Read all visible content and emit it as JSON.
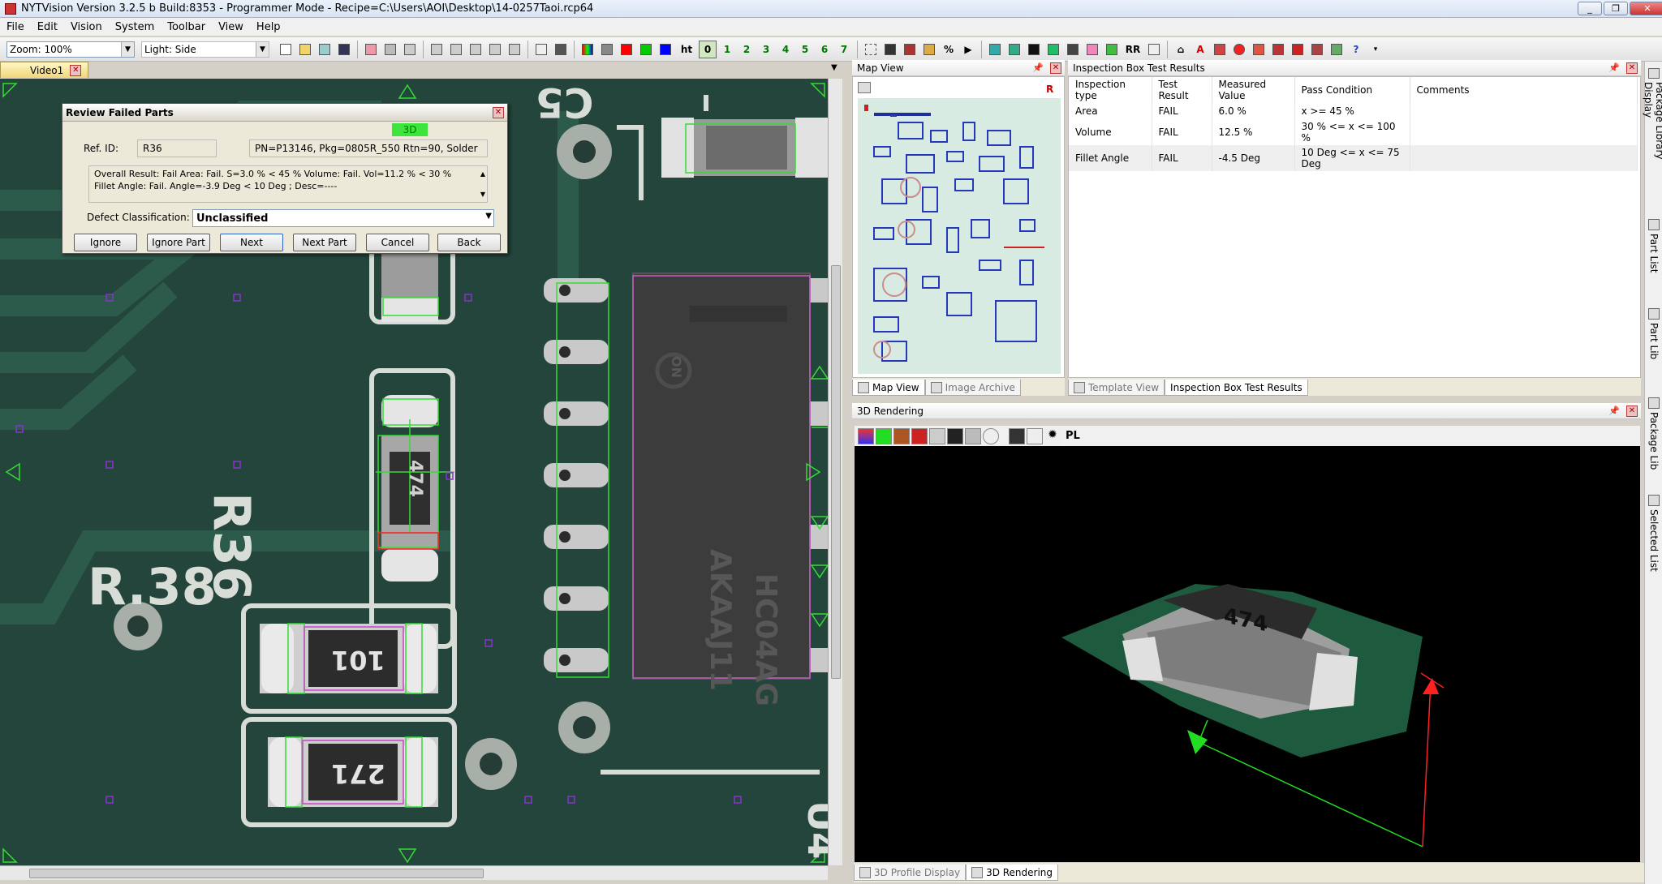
{
  "window": {
    "title": "NYTVision Version 3.2.5 b Build:8353 - Programmer Mode - Recipe=C:\\Users\\AOI\\Desktop\\14-0257Taoi.rcp64"
  },
  "menu": [
    "File",
    "Edit",
    "Vision",
    "System",
    "Toolbar",
    "View",
    "Help"
  ],
  "toolbar": {
    "zoom_value": "Zoom: 100%",
    "light_value": "Light: Side",
    "ht_label": "ht",
    "digits": [
      "0",
      "1",
      "2",
      "3",
      "4",
      "5",
      "6",
      "7"
    ],
    "rr_label": "RR"
  },
  "video": {
    "tab_label": "Video1",
    "silkscreen": {
      "r36": "R36",
      "r38": "R.38",
      "u4": "U4",
      "c5": "C5"
    },
    "chip_marks": {
      "r36": "474",
      "r101": "101",
      "r271": "271"
    },
    "ic_marks": {
      "line1": "ON",
      "line2": "HC04AG",
      "line3": "AKAAJ11"
    }
  },
  "dialog": {
    "title": "Review Failed Parts",
    "badge": "3D",
    "ref_label": "Ref. ID:",
    "ref_value": "R36",
    "part_info": "PN=P13146, Pkg=0805R_550 Rtn=90, Solder",
    "overall_result": "Overall Result: Fail Area: Fail. S=3.0 % < 45 % Volume: Fail. Vol=11.2 % < 30 % Fillet Angle: Fail. Angle=-3.9 Deg < 10 Deg ; Desc=----",
    "defect_label": "Defect Classification:",
    "defect_value": "Unclassified",
    "buttons": {
      "ignore": "Ignore",
      "ignore_part": "Ignore Part",
      "next": "Next",
      "next_part": "Next Part",
      "cancel": "Cancel",
      "back": "Back"
    }
  },
  "map_view": {
    "title": "Map View",
    "tabs": [
      "Map View",
      "Image Archive"
    ],
    "marker": "R"
  },
  "inspection": {
    "title": "Inspection Box Test Results",
    "columns": [
      "Inspection type",
      "Test Result",
      "Measured Value",
      "Pass Condition",
      "Comments"
    ],
    "rows": [
      [
        "Area",
        "FAIL",
        "6.0 %",
        "x >= 45 %",
        ""
      ],
      [
        "Volume",
        "FAIL",
        "12.5 %",
        "30 % <= x <= 100 %",
        ""
      ],
      [
        "Fillet Angle",
        "FAIL",
        "-4.5 Deg",
        "10 Deg <= x <= 75 Deg",
        ""
      ]
    ],
    "tabs": [
      "Template View",
      "Inspection Box Test Results"
    ]
  },
  "rendering": {
    "title": "3D Rendering",
    "toolbar_label": "PL",
    "chip_mark": "474",
    "tabs": [
      "3D Profile Display",
      "3D Rendering"
    ]
  },
  "sidebar": [
    "Package Library Display",
    "Part List",
    "Part Lib",
    "Package Lib",
    "Selected List"
  ],
  "colors": {
    "fail_green": "#3ee43e",
    "inspection_box": "#33dd33",
    "pad_box": "#cc44cc",
    "axis_red": "#ff2020"
  }
}
